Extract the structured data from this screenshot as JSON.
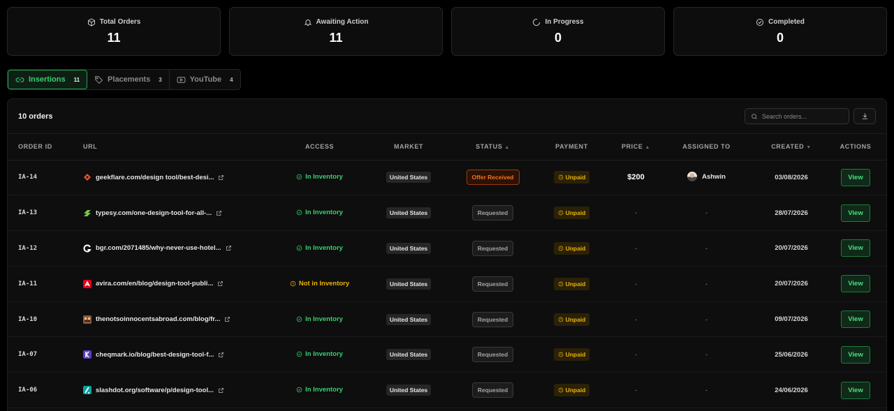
{
  "stats": [
    {
      "label": "Total Orders",
      "value": "11",
      "icon": "box-icon"
    },
    {
      "label": "Awaiting Action",
      "value": "11",
      "icon": "bell-icon"
    },
    {
      "label": "In Progress",
      "value": "0",
      "icon": "loader-icon"
    },
    {
      "label": "Completed",
      "value": "0",
      "icon": "check-circle-icon"
    }
  ],
  "tabs": [
    {
      "label": "Insertions",
      "count": "11",
      "icon": "link-icon"
    },
    {
      "label": "Placements",
      "count": "3",
      "icon": "tag-icon"
    },
    {
      "label": "YouTube",
      "count": "4",
      "icon": "youtube-icon"
    }
  ],
  "panel": {
    "title": "10 orders",
    "search_placeholder": "Search orders..."
  },
  "columns": {
    "order_id": "ORDER ID",
    "url": "URL",
    "access": "ACCESS",
    "market": "MARKET",
    "status": "STATUS",
    "payment": "PAYMENT",
    "price": "PRICE",
    "assigned": "ASSIGNED TO",
    "created": "CREATED",
    "actions": "ACTIONS"
  },
  "rows": [
    {
      "id": "IA-14",
      "url": "geekflare.com/design tool/best-desi...",
      "access": "In Inventory",
      "market": "United States",
      "status": "Offer Received",
      "payment": "Unpaid",
      "price": "$200",
      "assigned": "Ashwin",
      "created": "03/08/2026",
      "action": "View"
    },
    {
      "id": "IA-13",
      "url": "typesy.com/one-design-tool-for-all-...",
      "access": "In Inventory",
      "market": "United States",
      "status": "Requested",
      "payment": "Unpaid",
      "price": "-",
      "assigned": "-",
      "created": "28/07/2026",
      "action": "View"
    },
    {
      "id": "IA-12",
      "url": "bgr.com/2071485/why-never-use-hotel...",
      "access": "In Inventory",
      "market": "United States",
      "status": "Requested",
      "payment": "Unpaid",
      "price": "-",
      "assigned": "-",
      "created": "20/07/2026",
      "action": "View"
    },
    {
      "id": "IA-11",
      "url": "avira.com/en/blog/design-tool-publi...",
      "access": "Not in Inventory",
      "market": "United States",
      "status": "Requested",
      "payment": "Unpaid",
      "price": "-",
      "assigned": "-",
      "created": "20/07/2026",
      "action": "View"
    },
    {
      "id": "IA-10",
      "url": "thenotsoinnocentsabroad.com/blog/fr...",
      "access": "In Inventory",
      "market": "United States",
      "status": "Requested",
      "payment": "Unpaid",
      "price": "-",
      "assigned": "-",
      "created": "09/07/2026",
      "action": "View"
    },
    {
      "id": "IA-07",
      "url": "cheqmark.io/blog/best-design-tool-f...",
      "access": "In Inventory",
      "market": "United States",
      "status": "Requested",
      "payment": "Unpaid",
      "price": "-",
      "assigned": "-",
      "created": "25/06/2026",
      "action": "View"
    },
    {
      "id": "IA-06",
      "url": "slashdot.org/software/p/design-tool...",
      "access": "In Inventory",
      "market": "United States",
      "status": "Requested",
      "payment": "Unpaid",
      "price": "-",
      "assigned": "-",
      "created": "24/06/2026",
      "action": "View"
    }
  ],
  "colors": {
    "accent_green": "#34d36c",
    "warning_yellow": "#eab308",
    "offer_orange": "#f97316"
  }
}
